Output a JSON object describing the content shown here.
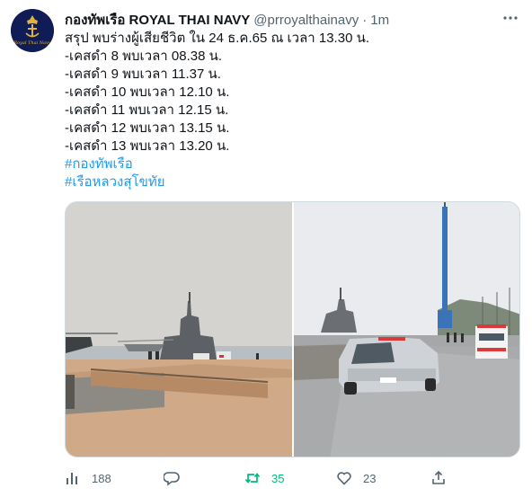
{
  "tweet": {
    "author": {
      "display_name": "กองทัพเรือ ROYAL THAI NAVY",
      "handle": "@prroyalthainavy",
      "avatar_text": "Royal Thai Navy"
    },
    "separator": "·",
    "timestamp": "1m",
    "lines": [
      "สรุป พบร่างผู้เสียชีวิต ใน 24 ธ.ค.65 ณ เวลา 13.30 น.",
      "-เคสดำ 8 พบเวลา 08.38 น.",
      "-เคสดำ 9 พบเวลา 11.37 น.",
      "-เคสดำ 10 พบเวลา 12.10 น.",
      "-เคสดำ 11 พบเวลา 12.15 น.",
      "-เคสดำ 12 พบเวลา 13.15 น.",
      "-เคสดำ 13 พบเวลา 13.20 น."
    ],
    "hashtags": [
      "#กองทัพเรือ",
      "#เรือหลวงสุโขทัย"
    ]
  },
  "media": {
    "photos": [
      {
        "icon": "navy-ship-pier-photo"
      },
      {
        "icon": "pickup-truck-ambulance-photo"
      }
    ]
  },
  "actions": {
    "views": {
      "icon": "analytics-icon",
      "count": "188"
    },
    "reply": {
      "icon": "reply-icon",
      "count": ""
    },
    "retweet": {
      "icon": "retweet-icon",
      "count": "35",
      "color": "#00ba7c"
    },
    "like": {
      "icon": "heart-icon",
      "count": "23"
    },
    "share": {
      "icon": "share-icon"
    }
  },
  "colors": {
    "text": "#0f1419",
    "muted": "#536471",
    "link": "#1d9bf0",
    "avatar_bg": "#0d1a4f"
  }
}
